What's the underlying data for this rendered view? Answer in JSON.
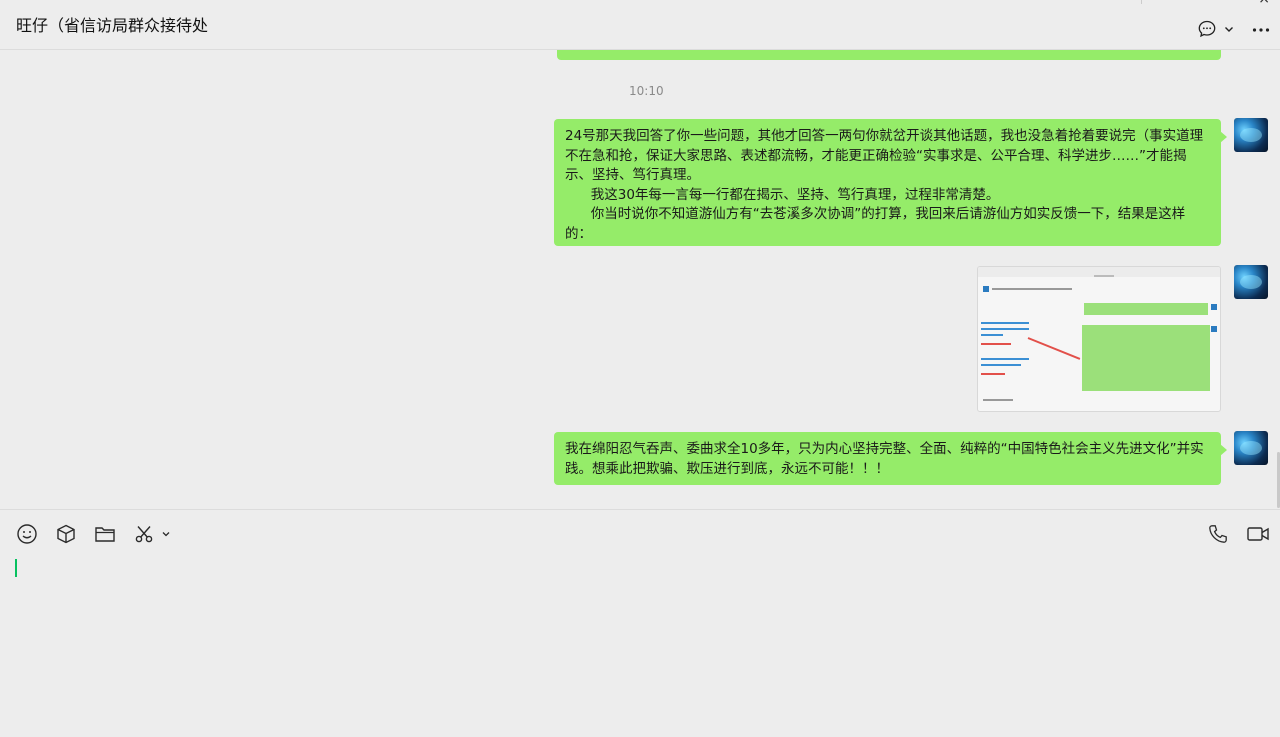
{
  "header": {
    "chat_title": "旺仔（省信访局群众接待处",
    "window_close": "×"
  },
  "messages": {
    "timestamp": "10:10",
    "msg1": "24号那天我回答了你一些问题，其他才回答一两句你就岔开谈其他话题，我也没急着抢着要说完（事实道理不在急和抢，保证大家思路、表述都流畅，才能更正确检验“实事求是、公平合理、科学进步……”才能揭示、坚持、笃行真理。\n      我这30年每一言每一行都在揭示、坚持、笃行真理，过程非常清楚。\n      你当时说你不知道游仙方有“去苍溪多次协调”的打算，我回来后请游仙方如实反馈一下，结果是这样的：",
    "msg3": "我在绵阳忍气吞声、委曲求全10多年，只为内心坚持完整、全面、纯粹的“中国特色社会主义先进文化”并实践。想乘此把欺骗、欺压进行到底，永远不可能！！！"
  },
  "icons": {
    "chat_icon": "chat-bubble-icon",
    "more_icon": "more-icon",
    "emoji_icon": "emoji-icon",
    "sticker_icon": "sticker-icon",
    "folder_icon": "folder-icon",
    "scissors_icon": "scissors-icon",
    "phone_icon": "phone-icon",
    "video_icon": "video-icon"
  },
  "colors": {
    "bubble": "#95ec69",
    "background": "#ededed",
    "caret": "#07c160"
  }
}
